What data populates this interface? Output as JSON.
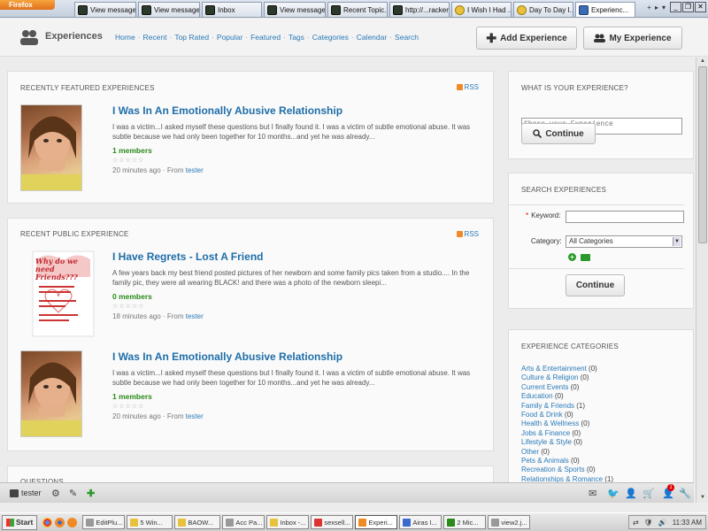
{
  "browser": {
    "app_button": "Firefox",
    "tabs": [
      {
        "label": "View message",
        "icon": "tab-favicon"
      },
      {
        "label": "View message",
        "icon": "tab-favicon"
      },
      {
        "label": "Inbox",
        "icon": "tab-favicon"
      },
      {
        "label": "View message",
        "icon": "tab-favicon"
      },
      {
        "label": "Recent Topic...",
        "icon": "tab-favicon"
      },
      {
        "label": "http://...racker",
        "icon": "tab-favicon"
      },
      {
        "label": "I Wish I Had ...",
        "icon": "tab-favicon"
      },
      {
        "label": "Day To Day I...",
        "icon": "tab-favicon"
      },
      {
        "label": "Experienc...",
        "icon": "tab-favicon",
        "active": true
      }
    ]
  },
  "header": {
    "title": "Experiences",
    "nav": [
      "Home",
      "Recent",
      "Top Rated",
      "Popular",
      "Featured",
      "Tags",
      "Categories",
      "Calendar",
      "Search"
    ],
    "add_button": "Add Experience",
    "my_button": "My Experience"
  },
  "featured": {
    "title": "RECENTLY FEATURED EXPERIENCES",
    "rss": "RSS",
    "items": [
      {
        "title": "I Was In An Emotionally Abusive Relationship",
        "desc": "I was a victim...I asked myself these questions but I finally found it. I was a victim of subtle emotional abuse. It was subtle because we had only been together for 10 months...and yet he was already...",
        "members": "1 members",
        "stars": "☆☆☆☆☆",
        "time": "20 minutes ago",
        "from": "From",
        "author": "tester"
      }
    ]
  },
  "public": {
    "title": "RECENT PUBLIC EXPERIENCE",
    "rss": "RSS",
    "items": [
      {
        "title": "I Have Regrets - Lost A Friend",
        "desc": "A few years back my best friend posted pictures of her newborn and some family pics taken from a studio.... In the family pic, they were all wearing BLACK! and there was a photo of the newborn sleepi...",
        "members": "0 members",
        "stars": "☆☆☆☆☆",
        "time": "18 minutes ago",
        "from": "From",
        "author": "tester",
        "thumb_text": "Why do we need Friends???"
      },
      {
        "title": "I Was In An Emotionally Abusive Relationship",
        "desc": "I was a victim...I asked myself these questions but I finally found it. I was a victim of subtle emotional abuse. It was subtle because we had only been together for 10 months...and yet he was already...",
        "members": "1 members",
        "stars": "☆☆☆☆☆",
        "time": "20 minutes ago",
        "from": "From",
        "author": "tester"
      }
    ]
  },
  "questions": {
    "title": "QUESTIONS"
  },
  "share": {
    "title": "WHAT IS YOUR EXPERIENCE?",
    "placeholder": "Share your Experience",
    "button": "Continue"
  },
  "search": {
    "title": "SEARCH EXPERIENCES",
    "keyword_label": "Keyword:",
    "required_mark": "*",
    "category_label": "Category:",
    "category_value": "All Categories",
    "button": "Continue"
  },
  "categories": {
    "title": "EXPERIENCE CATEGORIES",
    "items": [
      {
        "name": "Arts & Entertainment",
        "count": "(0)"
      },
      {
        "name": "Culture & Religion",
        "count": "(0)"
      },
      {
        "name": "Current Events",
        "count": "(0)"
      },
      {
        "name": "Education",
        "count": "(0)"
      },
      {
        "name": "Family & Friends",
        "count": "(1)"
      },
      {
        "name": "Food & Drink",
        "count": "(0)"
      },
      {
        "name": "Health & Wellness",
        "count": "(0)"
      },
      {
        "name": "Jobs & Finance",
        "count": "(0)"
      },
      {
        "name": "Lifestyle & Style",
        "count": "(0)"
      },
      {
        "name": "Other",
        "count": "(0)"
      },
      {
        "name": "Pets & Animals",
        "count": "(0)"
      },
      {
        "name": "Recreation & Sports",
        "count": "(0)"
      },
      {
        "name": "Relationships & Romance",
        "count": "(1)"
      }
    ]
  },
  "bottom_bar": {
    "username": "tester",
    "notification_count": "1"
  },
  "taskbar": {
    "start": "Start",
    "tasks": [
      "EditPlu...",
      "5 Win...",
      "BAOW...",
      "Acc Pa...",
      "Inbox -...",
      "sexsell...",
      "Experi...",
      "Airas I...",
      "2 Mic...",
      "view2.j..."
    ],
    "active_index": 6,
    "clock": "11:33 AM"
  },
  "colors": {
    "link": "#2a7ab8",
    "title_blue": "#1f6ea8",
    "members_green": "#2a8a1a"
  }
}
